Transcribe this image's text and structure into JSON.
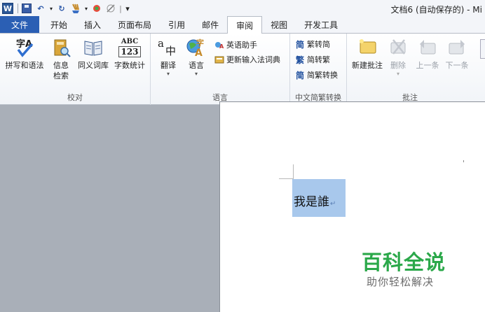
{
  "window": {
    "title": "文档6 (自动保存的) - Mi"
  },
  "qat": {
    "word_logo": "W",
    "undo_icon": "↶",
    "redo_icon": "↻",
    "separator": "|",
    "customize": "▾"
  },
  "tabs": [
    {
      "label": "文件"
    },
    {
      "label": "开始"
    },
    {
      "label": "插入"
    },
    {
      "label": "页面布局"
    },
    {
      "label": "引用"
    },
    {
      "label": "邮件"
    },
    {
      "label": "审阅"
    },
    {
      "label": "视图"
    },
    {
      "label": "开发工具"
    }
  ],
  "ribbon": {
    "proofing": {
      "label": "校对",
      "spelling": "拼写和语法",
      "info_line1": "信息",
      "info_line2": "检索",
      "thesaurus": "同义词库",
      "wordcount": "字数统计",
      "abc_top": "ABC",
      "abc_bottom": "123"
    },
    "language": {
      "label": "语言",
      "translate": "翻译",
      "language": "语言",
      "english_assistant": "英语助手",
      "update_ime": "更新输入法词典"
    },
    "chinese_conversion": {
      "label": "中文简繁转换",
      "to_simplified": "繁转简",
      "to_traditional": "简转繁",
      "convert": "简繁转换"
    },
    "comments": {
      "label": "批注",
      "new_comment": "新建批注",
      "delete": "删除",
      "previous": "上一条",
      "next": "下一条"
    }
  },
  "document": {
    "text": "我是誰",
    "para_mark": "↵"
  },
  "watermark": {
    "title": "百科全说",
    "subtitle": "助你轻松解决"
  }
}
